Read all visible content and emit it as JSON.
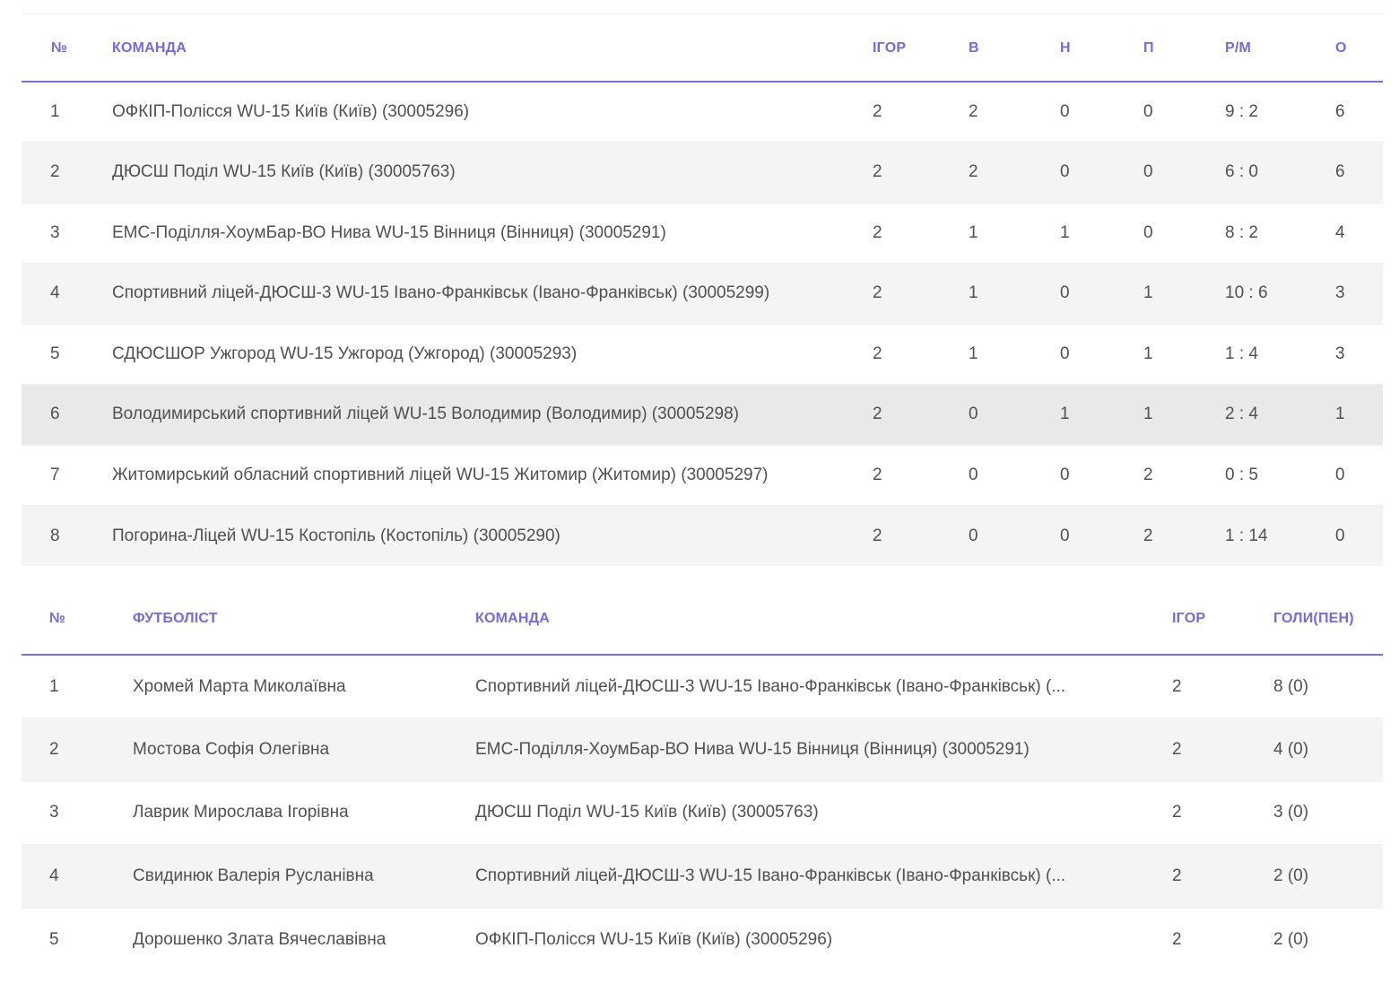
{
  "standings": {
    "headers": [
      "№",
      "КОМАНДА",
      "ІГОР",
      "В",
      "Н",
      "П",
      "Р/М",
      "О"
    ],
    "rows": [
      {
        "no": "1",
        "team": "ОФКІП-Полісся WU-15 Київ (Київ) (30005296)",
        "games": "2",
        "w": "2",
        "d": "0",
        "l": "0",
        "gd": "9 : 2",
        "pts": "6"
      },
      {
        "no": "2",
        "team": "ДЮСШ Поділ WU-15 Київ (Київ) (30005763)",
        "games": "2",
        "w": "2",
        "d": "0",
        "l": "0",
        "gd": "6 : 0",
        "pts": "6"
      },
      {
        "no": "3",
        "team": "ЕМС-Поділля-ХоумБар-ВО Нива WU-15 Вінниця (Вінниця) (30005291)",
        "games": "2",
        "w": "1",
        "d": "1",
        "l": "0",
        "gd": "8 : 2",
        "pts": "4"
      },
      {
        "no": "4",
        "team": "Спортивний ліцей-ДЮСШ-3 WU-15 Івано-Франківськ (Івано-Франківськ) (30005299)",
        "games": "2",
        "w": "1",
        "d": "0",
        "l": "1",
        "gd": "10 : 6",
        "pts": "3"
      },
      {
        "no": "5",
        "team": "СДЮСШОР Ужгород WU-15 Ужгород (Ужгород) (30005293)",
        "games": "2",
        "w": "1",
        "d": "0",
        "l": "1",
        "gd": "1 : 4",
        "pts": "3"
      },
      {
        "no": "6",
        "team": "Володимирський спортивний ліцей WU-15 Володимир (Володимир) (30005298)",
        "games": "2",
        "w": "0",
        "d": "1",
        "l": "1",
        "gd": "2 : 4",
        "pts": "1"
      },
      {
        "no": "7",
        "team": "Житомирський обласний спортивний ліцей WU-15 Житомир (Житомир) (30005297)",
        "games": "2",
        "w": "0",
        "d": "0",
        "l": "2",
        "gd": "0 : 5",
        "pts": "0"
      },
      {
        "no": "8",
        "team": "Погорина-Ліцей WU-15 Костопіль (Костопіль) (30005290)",
        "games": "2",
        "w": "0",
        "d": "0",
        "l": "2",
        "gd": "1 : 14",
        "pts": "0"
      }
    ]
  },
  "scorers": {
    "headers": [
      "№",
      "ФУТБОЛІСТ",
      "КОМАНДА",
      "ІГОР",
      "ГОЛИ(ПЕН)"
    ],
    "rows": [
      {
        "no": "1",
        "player": "Хромей Марта Миколаївна",
        "team": "Спортивний ліцей-ДЮСШ-3 WU-15 Івано-Франківськ (Івано-Франківськ) (...",
        "games": "2",
        "goals": "8 (0)"
      },
      {
        "no": "2",
        "player": "Мостова Софія Олегівна",
        "team": "ЕМС-Поділля-ХоумБар-ВО Нива WU-15 Вінниця (Вінниця) (30005291)",
        "games": "2",
        "goals": "4 (0)"
      },
      {
        "no": "3",
        "player": "Лаврик Мирослава Ігорівна",
        "team": "ДЮСШ Поділ WU-15 Київ (Київ) (30005763)",
        "games": "2",
        "goals": "3 (0)"
      },
      {
        "no": "4",
        "player": "Свидинюк Валерія Русланівна",
        "team": "Спортивний ліцей-ДЮСШ-3 WU-15 Івано-Франківськ (Івано-Франківськ) (...",
        "games": "2",
        "goals": "2 (0)"
      },
      {
        "no": "5",
        "player": "Дорошенко Злата Вячеславівна",
        "team": "ОФКІП-Полісся WU-15 Київ (Київ) (30005296)",
        "games": "2",
        "goals": "2 (0)"
      }
    ]
  },
  "colors": {
    "accent": "#7b68d8",
    "stripe": "#f4f4f4",
    "hover": "#e9e9ea"
  }
}
